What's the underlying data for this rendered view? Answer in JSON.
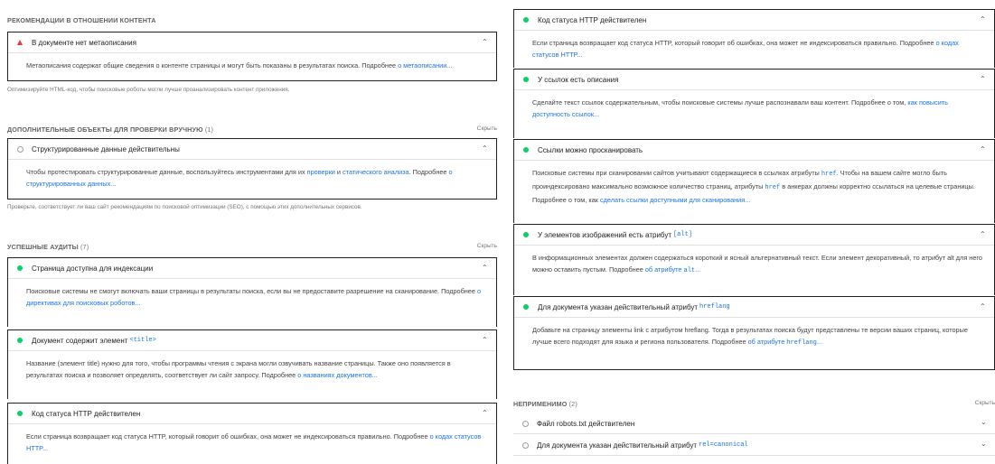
{
  "left": {
    "recommendations": {
      "title": "РЕКОМЕНДАЦИИ В ОТНОШЕНИИ КОНТЕНТА",
      "audit": {
        "title": "В документе нет метаописания",
        "body": "Метаописания содержат общие сведения о контенте страницы и могут быть показаны в результатах поиска. Подробнее ",
        "link": "о метаописании..."
      },
      "description": "Оптимизируйте HTML-код, чтобы поисковые роботы могли лучше проанализировать контент приложения."
    },
    "manual": {
      "title": "ДОПОЛНИТЕЛЬНЫЕ ОБЪЕКТЫ ДЛЯ ПРОВЕРКИ ВРУЧНУЮ",
      "count": "(1)",
      "hide": "Скрыть",
      "audit": {
        "title": "Структурированные данные действительны",
        "body1": "Чтобы протестировать структурированные данные, воспользуйтесь инструментами для их ",
        "link1": "проверки",
        "body2": " и ",
        "link2": "статического анализа",
        "body3": ". Подробнее ",
        "link3": "о структурированных данных..."
      },
      "description": "Проверьте, соответствует ли ваш сайт рекомендациям по поисковой оптимизации (SEO), с помощью этих дополнительных сервисов."
    },
    "passed": {
      "title": "УСПЕШНЫЕ АУДИТЫ",
      "count": "(7)",
      "hide": "Скрыть",
      "audits": [
        {
          "title": "Страница доступна для индексации",
          "body": "Поисковые системы не смогут включать ваши страницы в результаты поиска, если вы не предоставите разрешение на сканирование. Подробнее ",
          "link": "о директивах для поисковых роботов..."
        },
        {
          "title": "Документ содержит элемент ",
          "code": "<title>",
          "body": "Название (элемент title) нужно для того, чтобы программы чтения с экрана могли озвучивать название страницы. Также оно появляется в результатах поиска и позволяет определять, соответствует ли сайт запросу. Подробнее ",
          "link": "о названиях документов..."
        },
        {
          "title": "Код статуса HTTP действителен",
          "body": "Если страница возвращает код статуса HTTP, который говорит об ошибках, она может не индексироваться правильно. Подробнее ",
          "link": "о кодах статусов HTTP..."
        }
      ]
    }
  },
  "right": {
    "audits": [
      {
        "title": "Код статуса HTTP действителен",
        "body": "Если страница возвращает код статуса HTTP, который говорит об ошибках, она может не индексироваться правильно. Подробнее ",
        "link": "о кодах статусов HTTP..."
      },
      {
        "title": "У ссылок есть описания",
        "body": "Сделайте текст ссылок содержательным, чтобы поисковые системы лучше распознавали ваш контент. Подробнее о том, ",
        "link": "как повысить доступность ссылок..."
      },
      {
        "title": "Ссылки можно просканировать",
        "body1": "Поисковые системы при сканировании сайтов учитывают содержащиеся в ссылках атрибуты ",
        "code1": "href",
        "body2": ". Чтобы на вашем сайте могло быть проиндексировано максимально возможное количество страниц, атрибуты ",
        "code2": "href",
        "body3": " в анкерах должны корректно ссылаться на целевые страницы. Подробнее о том, как ",
        "link": "сделать ссылки доступными для сканирования..."
      },
      {
        "title": "У элементов изображений есть атрибут ",
        "code": "[alt]",
        "body": "В информационных элементах должен содержаться короткий и ясный альтернативный текст. Если элемент декоративный, то атрибут alt для него можно оставить пустым. Подробнее ",
        "link": "об атрибуте ",
        "link_code": "alt",
        "link_tail": "..."
      },
      {
        "title": "Для документа указан действительный атрибут ",
        "code": "hreflang",
        "body": "Добавьте на страницу элементы link с атрибутом hreflang. Тогда в результатах поиска будут представлены те версии ваших страниц, которые лучше всего подходят для языка и региона пользователя. Подробнее ",
        "link": "об атрибуте ",
        "link_code": "hreflang",
        "link_tail": "..."
      }
    ],
    "not_applicable": {
      "title": "НЕПРИМЕНИМО",
      "count": "(2)",
      "hide": "Скрыть",
      "items": [
        {
          "title": "Файл robots.txt действителен"
        },
        {
          "title": "Для документа указан действительный атрибут ",
          "code": "rel=canonical"
        }
      ]
    }
  },
  "colors": {
    "pass": "#0cce6b",
    "fail": "#e53935",
    "link": "#1a73e8"
  }
}
